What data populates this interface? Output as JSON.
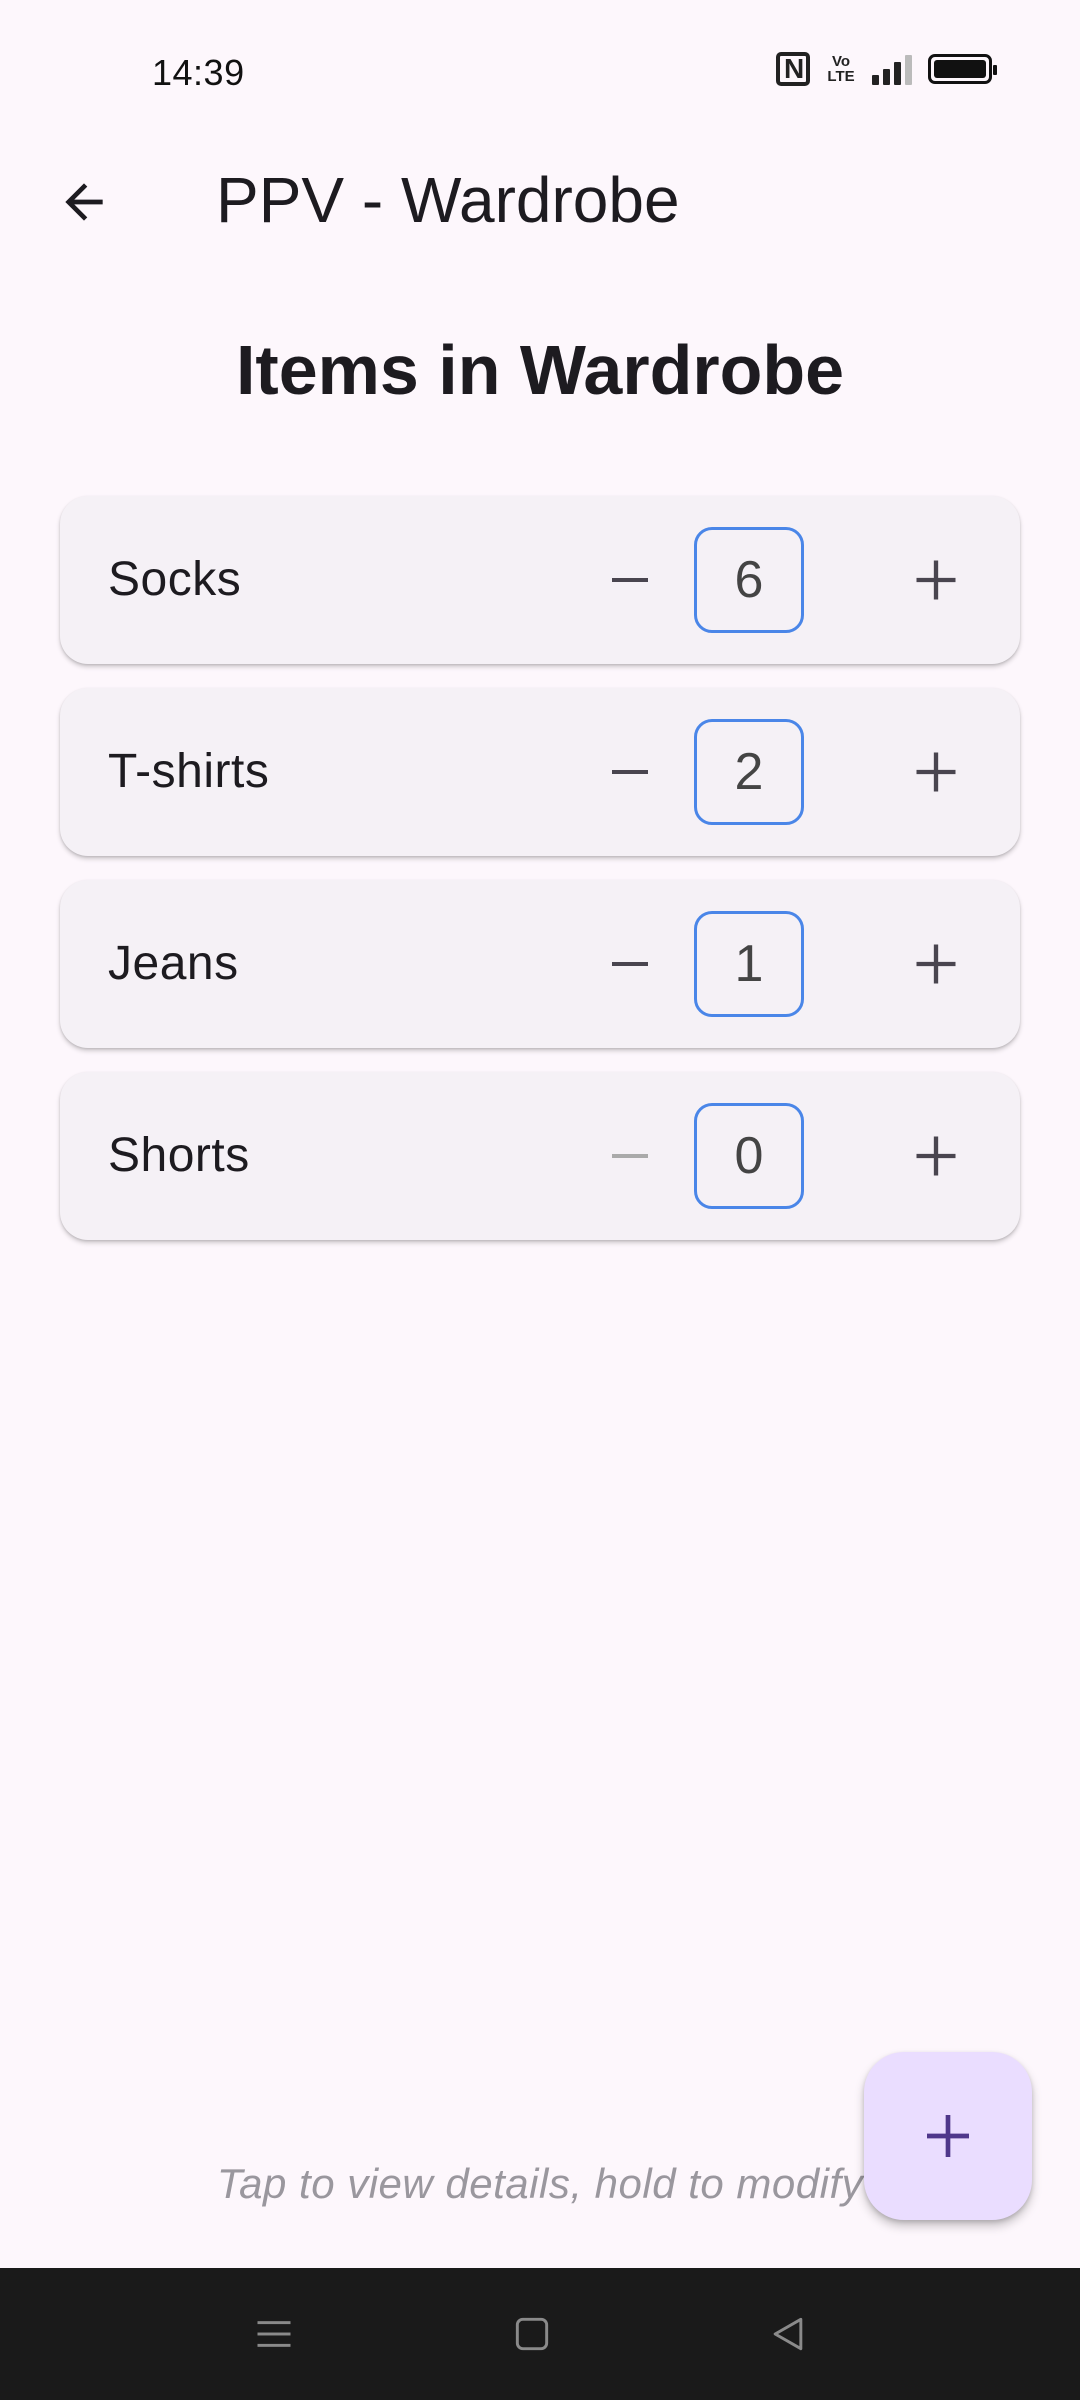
{
  "status_bar": {
    "time": "14:39",
    "volte_label": "Vo\nLTE",
    "icons": [
      "nfc-icon",
      "volte-icon",
      "signal-icon",
      "battery-icon"
    ]
  },
  "app_bar": {
    "title": "PPV - Wardrobe",
    "back_icon": "arrow-left-icon"
  },
  "heading": "Items in Wardrobe",
  "items": [
    {
      "name": "Socks",
      "count": "6",
      "decrement_enabled": true
    },
    {
      "name": "T-shirts",
      "count": "2",
      "decrement_enabled": true
    },
    {
      "name": "Jeans",
      "count": "1",
      "decrement_enabled": true
    },
    {
      "name": "Shorts",
      "count": "0",
      "decrement_enabled": false
    }
  ],
  "hint": "Tap to view details, hold to modify",
  "fab": {
    "icon": "plus-icon"
  },
  "nav_bar": {
    "icons": [
      "menu-icon",
      "home-icon",
      "back-triangle-icon"
    ]
  },
  "colors": {
    "background": "#fdf7fc",
    "card": "#f5f1f6",
    "count_border": "#4a86e8",
    "fab": "#eaddff",
    "fab_icon": "#4f378b",
    "disabled_icon": "#aaaaaa"
  }
}
